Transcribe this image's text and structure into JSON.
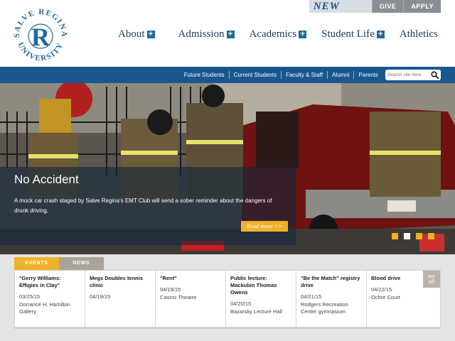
{
  "logo": {
    "top_text": "SALVE REGINA",
    "bottom_text": "UNIVERSITY",
    "monogram": "R"
  },
  "topbar": {
    "brand": "NEW",
    "give_label": "GIVE",
    "apply_label": "APPLY"
  },
  "main_nav": [
    {
      "label": "About",
      "has_plus": true
    },
    {
      "label": "Admission",
      "has_plus": true
    },
    {
      "label": "Academics",
      "has_plus": true
    },
    {
      "label": "Student Life",
      "has_plus": true
    },
    {
      "label": "Athletics",
      "has_plus": false
    }
  ],
  "sub_nav": [
    "Future Students",
    "Current Students",
    "Faculty & Staff",
    "Alumni",
    "Parents"
  ],
  "search": {
    "placeholder": "Search site here",
    "icon": "search-icon"
  },
  "hero": {
    "title": "No Accident",
    "text": "A mock car crash staged by Salve Regina's EMT Club will send a sober reminder about the dangers of drunk driving.",
    "read_more": "Read more >>",
    "slides_total": 4,
    "active_slide": 2
  },
  "tabs": {
    "events": "EVENTS",
    "news": "NEWS"
  },
  "events": [
    {
      "title": "\"Gerry Williams: Effigies in Clay\"",
      "date": "03/25/15",
      "location": "Dorrance H. Hamilton Gallery"
    },
    {
      "title": "Megs Doubles tennis clinic",
      "date": "04/19/15",
      "location": ""
    },
    {
      "title": "\"Rent\"",
      "date": "04/19/15",
      "location": "Casino Theatre"
    },
    {
      "title": "Public lecture: Mackubin Thomas Owens",
      "date": "04/20/15",
      "location": "Bazarsky Lecture Hall"
    },
    {
      "title": "\"Be the Match\" registry drive",
      "date": "04/21/15",
      "location": "Rodgers Recreation Center gymnasium"
    },
    {
      "title": "Blood drive",
      "date": "04/22/15",
      "location": "Ochre Court"
    }
  ],
  "see_all": {
    "line1": "see",
    "line2": "all"
  },
  "colors": {
    "brand_blue": "#1d6aa3",
    "nav_bar": "#19578e",
    "accent_gold": "#f0b12a",
    "nav_text": "#1e3c5a"
  }
}
